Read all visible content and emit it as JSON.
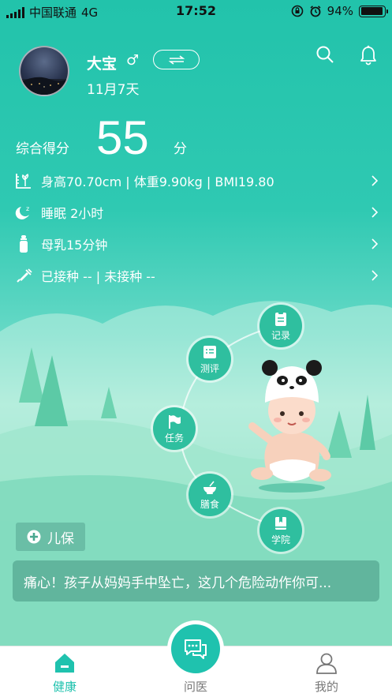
{
  "status_bar": {
    "carrier": "中国联通",
    "network": "4G",
    "time": "17:52",
    "battery": "94%",
    "battery_level": 0.94
  },
  "profile": {
    "name": "大宝",
    "gender_symbol": "♂",
    "age": "11月7天"
  },
  "score": {
    "label": "综合得分",
    "value": "55",
    "unit": "分"
  },
  "metrics": [
    {
      "icon": "height-scale-icon",
      "text": "身高70.70cm | 体重9.90kg | BMI19.80"
    },
    {
      "icon": "moon-sleep-icon",
      "text": "睡眠 2小时"
    },
    {
      "icon": "bottle-icon",
      "text": "母乳15分钟"
    },
    {
      "icon": "syringe-icon",
      "text": "已接种 -- | 未接种 --"
    }
  ],
  "menu": {
    "record": "记录",
    "assessment": "测评",
    "task": "任务",
    "diet": "膳食",
    "academy": "学院"
  },
  "child_care_tag": "儿保",
  "news_text": "痛心！孩子从妈妈手中坠亡，这几个危险动作你可...",
  "tabs": {
    "health": "健康",
    "consult": "问医",
    "mine": "我的"
  },
  "colors": {
    "accent": "#1fc2ae",
    "header_bg": "#22c3ab",
    "menu_circle": "#2fbf9f"
  }
}
